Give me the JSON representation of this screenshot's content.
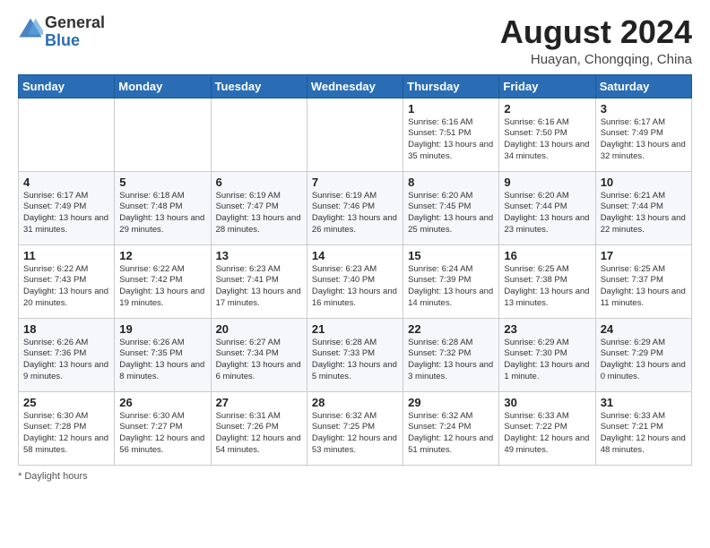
{
  "header": {
    "logo_general": "General",
    "logo_blue": "Blue",
    "month_title": "August 2024",
    "location": "Huayan, Chongqing, China"
  },
  "days_of_week": [
    "Sunday",
    "Monday",
    "Tuesday",
    "Wednesday",
    "Thursday",
    "Friday",
    "Saturday"
  ],
  "weeks": [
    [
      {
        "day": "",
        "info": ""
      },
      {
        "day": "",
        "info": ""
      },
      {
        "day": "",
        "info": ""
      },
      {
        "day": "",
        "info": ""
      },
      {
        "day": "1",
        "info": "Sunrise: 6:16 AM\nSunset: 7:51 PM\nDaylight: 13 hours\nand 35 minutes."
      },
      {
        "day": "2",
        "info": "Sunrise: 6:16 AM\nSunset: 7:50 PM\nDaylight: 13 hours\nand 34 minutes."
      },
      {
        "day": "3",
        "info": "Sunrise: 6:17 AM\nSunset: 7:49 PM\nDaylight: 13 hours\nand 32 minutes."
      }
    ],
    [
      {
        "day": "4",
        "info": "Sunrise: 6:17 AM\nSunset: 7:49 PM\nDaylight: 13 hours\nand 31 minutes."
      },
      {
        "day": "5",
        "info": "Sunrise: 6:18 AM\nSunset: 7:48 PM\nDaylight: 13 hours\nand 29 minutes."
      },
      {
        "day": "6",
        "info": "Sunrise: 6:19 AM\nSunset: 7:47 PM\nDaylight: 13 hours\nand 28 minutes."
      },
      {
        "day": "7",
        "info": "Sunrise: 6:19 AM\nSunset: 7:46 PM\nDaylight: 13 hours\nand 26 minutes."
      },
      {
        "day": "8",
        "info": "Sunrise: 6:20 AM\nSunset: 7:45 PM\nDaylight: 13 hours\nand 25 minutes."
      },
      {
        "day": "9",
        "info": "Sunrise: 6:20 AM\nSunset: 7:44 PM\nDaylight: 13 hours\nand 23 minutes."
      },
      {
        "day": "10",
        "info": "Sunrise: 6:21 AM\nSunset: 7:44 PM\nDaylight: 13 hours\nand 22 minutes."
      }
    ],
    [
      {
        "day": "11",
        "info": "Sunrise: 6:22 AM\nSunset: 7:43 PM\nDaylight: 13 hours\nand 20 minutes."
      },
      {
        "day": "12",
        "info": "Sunrise: 6:22 AM\nSunset: 7:42 PM\nDaylight: 13 hours\nand 19 minutes."
      },
      {
        "day": "13",
        "info": "Sunrise: 6:23 AM\nSunset: 7:41 PM\nDaylight: 13 hours\nand 17 minutes."
      },
      {
        "day": "14",
        "info": "Sunrise: 6:23 AM\nSunset: 7:40 PM\nDaylight: 13 hours\nand 16 minutes."
      },
      {
        "day": "15",
        "info": "Sunrise: 6:24 AM\nSunset: 7:39 PM\nDaylight: 13 hours\nand 14 minutes."
      },
      {
        "day": "16",
        "info": "Sunrise: 6:25 AM\nSunset: 7:38 PM\nDaylight: 13 hours\nand 13 minutes."
      },
      {
        "day": "17",
        "info": "Sunrise: 6:25 AM\nSunset: 7:37 PM\nDaylight: 13 hours\nand 11 minutes."
      }
    ],
    [
      {
        "day": "18",
        "info": "Sunrise: 6:26 AM\nSunset: 7:36 PM\nDaylight: 13 hours\nand 9 minutes."
      },
      {
        "day": "19",
        "info": "Sunrise: 6:26 AM\nSunset: 7:35 PM\nDaylight: 13 hours\nand 8 minutes."
      },
      {
        "day": "20",
        "info": "Sunrise: 6:27 AM\nSunset: 7:34 PM\nDaylight: 13 hours\nand 6 minutes."
      },
      {
        "day": "21",
        "info": "Sunrise: 6:28 AM\nSunset: 7:33 PM\nDaylight: 13 hours\nand 5 minutes."
      },
      {
        "day": "22",
        "info": "Sunrise: 6:28 AM\nSunset: 7:32 PM\nDaylight: 13 hours\nand 3 minutes."
      },
      {
        "day": "23",
        "info": "Sunrise: 6:29 AM\nSunset: 7:30 PM\nDaylight: 13 hours\nand 1 minute."
      },
      {
        "day": "24",
        "info": "Sunrise: 6:29 AM\nSunset: 7:29 PM\nDaylight: 13 hours\nand 0 minutes."
      }
    ],
    [
      {
        "day": "25",
        "info": "Sunrise: 6:30 AM\nSunset: 7:28 PM\nDaylight: 12 hours\nand 58 minutes."
      },
      {
        "day": "26",
        "info": "Sunrise: 6:30 AM\nSunset: 7:27 PM\nDaylight: 12 hours\nand 56 minutes."
      },
      {
        "day": "27",
        "info": "Sunrise: 6:31 AM\nSunset: 7:26 PM\nDaylight: 12 hours\nand 54 minutes."
      },
      {
        "day": "28",
        "info": "Sunrise: 6:32 AM\nSunset: 7:25 PM\nDaylight: 12 hours\nand 53 minutes."
      },
      {
        "day": "29",
        "info": "Sunrise: 6:32 AM\nSunset: 7:24 PM\nDaylight: 12 hours\nand 51 minutes."
      },
      {
        "day": "30",
        "info": "Sunrise: 6:33 AM\nSunset: 7:22 PM\nDaylight: 12 hours\nand 49 minutes."
      },
      {
        "day": "31",
        "info": "Sunrise: 6:33 AM\nSunset: 7:21 PM\nDaylight: 12 hours\nand 48 minutes."
      }
    ]
  ],
  "footer": {
    "note": "Daylight hours"
  }
}
